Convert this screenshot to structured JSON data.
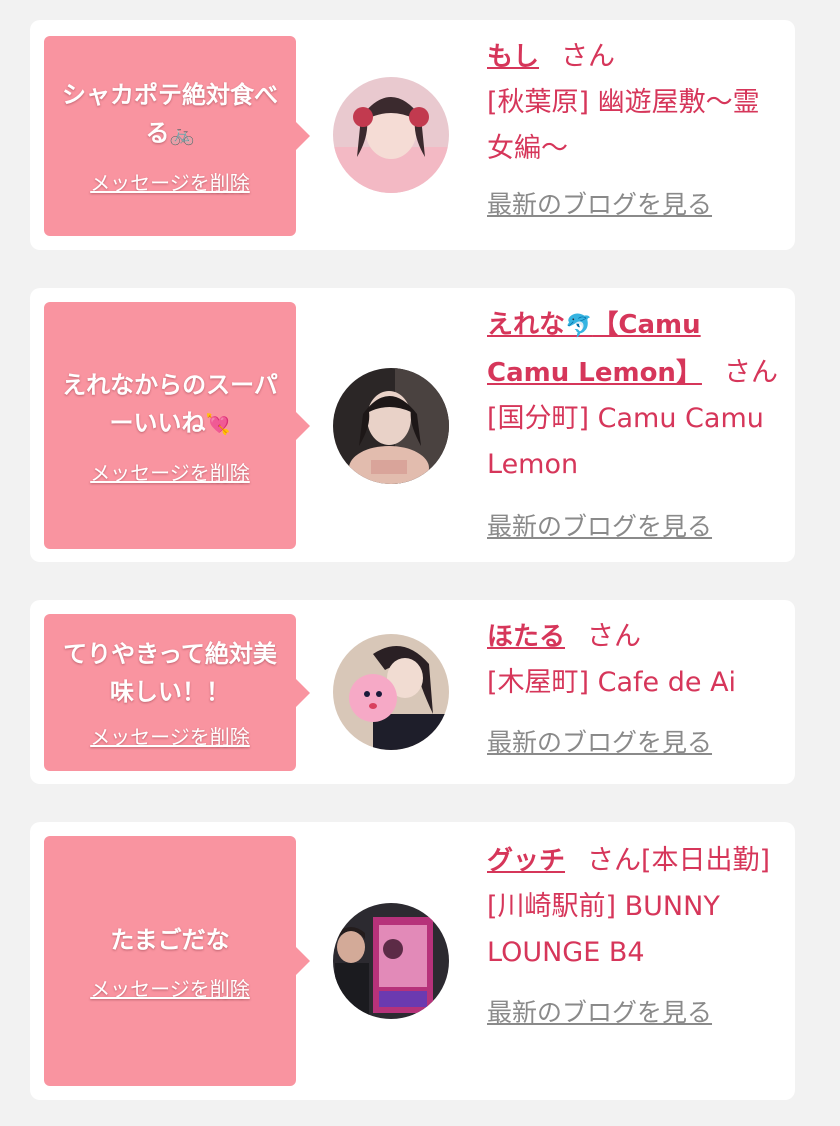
{
  "colors": {
    "page_background": "#f2f2f2",
    "card_background": "#ffffff",
    "bubble_background": "#f994a0",
    "accent_text": "#d6365a",
    "link_gray": "#8a8a8a"
  },
  "entries": [
    {
      "message": "シャカポテ絶対食べる",
      "message_emoji": "🚲",
      "delete_label": "メッセージを削除",
      "name": "もし",
      "name_icon": "",
      "name_suffix": "",
      "san": "さん",
      "san_extra": "",
      "shop": "[秋葉原] 幽遊屋敷〜霊女編〜",
      "blog_link": "最新のブログを見る",
      "avatar_icon": "avatar-photo"
    },
    {
      "message": "えれなからのスーパーいいね",
      "message_emoji": "💘",
      "delete_label": "メッセージを削除",
      "name": "えれな",
      "name_icon": "🐬",
      "name_suffix": "【Camu Camu Lemon】",
      "san": "さん",
      "san_extra": "",
      "shop": "[国分町] Camu Camu Lemon",
      "blog_link": "最新のブログを見る",
      "avatar_icon": "avatar-photo"
    },
    {
      "message": "てりやきって絶対美味しい！！",
      "message_emoji": "",
      "delete_label": "メッセージを削除",
      "name": "ほたる",
      "name_icon": "",
      "name_suffix": "",
      "san": "さん",
      "san_extra": "",
      "shop": "[木屋町] Cafe de Ai",
      "blog_link": "最新のブログを見る",
      "avatar_icon": "avatar-photo"
    },
    {
      "message": "たまごだな",
      "message_emoji": "",
      "delete_label": "メッセージを削除",
      "name": "グッチ",
      "name_icon": "",
      "name_suffix": "",
      "san": "さん",
      "san_extra": "[本日出勤]",
      "shop": "[川崎駅前] BUNNY LOUNGE B4",
      "blog_link": "最新のブログを見る",
      "avatar_icon": "avatar-photo"
    }
  ]
}
